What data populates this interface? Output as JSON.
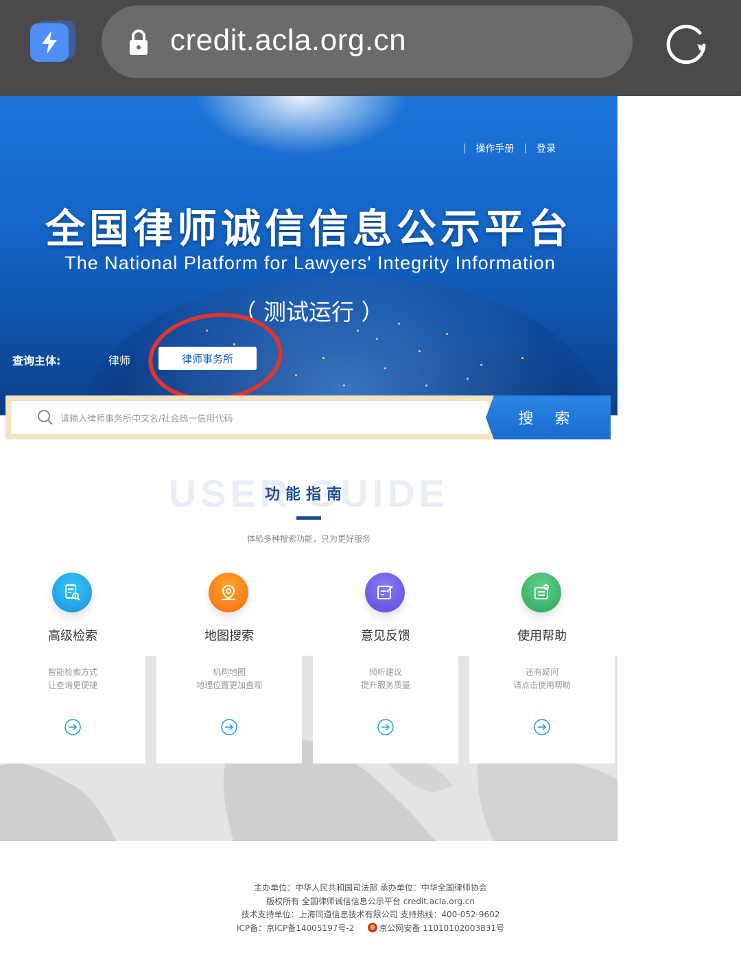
{
  "browser": {
    "url": "credit.acla.org.cn",
    "app_icon": "lightning-app-icon",
    "lock_icon": "lock-icon",
    "reload_icon": "reload-icon"
  },
  "hero": {
    "links": [
      "操作手册",
      "登录"
    ],
    "title": "全国律师诚信信息公示平台",
    "subtitle": "The National Platform for  Lawyers' Integrity Information",
    "status": "（ 测试运行 ）",
    "query_label": "查询主体:",
    "options": [
      {
        "label": "律师",
        "selected": false
      },
      {
        "label": "律师事务所",
        "selected": true
      }
    ]
  },
  "search": {
    "placeholder": "请输入律师事务所中文名/社会统一信用代码",
    "button_label": "搜 索"
  },
  "guide": {
    "watermark": "USER GUIDE",
    "title": "功能指南",
    "description": "体验多种搜索功能，只为更好服务"
  },
  "features": [
    {
      "title": "高级检索",
      "line1": "智能检索方式",
      "line2": "让查询更便捷",
      "icon": "search-document-icon",
      "color": "#1aa5e8"
    },
    {
      "title": "地图搜索",
      "line1": "机构地图",
      "line2": "地理位置更加直观",
      "icon": "map-pin-icon",
      "color": "#f5820f"
    },
    {
      "title": "意见反馈",
      "line1": "倾听建议",
      "line2": "提升服务质量",
      "icon": "feedback-edit-icon",
      "color": "#6b5ee6"
    },
    {
      "title": "使用帮助",
      "line1": "还有疑问",
      "line2": "请点击使用帮助",
      "icon": "help-notes-icon",
      "color": "#3fb66b"
    }
  ],
  "footer": {
    "line1": "主办单位：中华人民共和国司法部 承办单位：中华全国律师协会",
    "line2": "版权所有 全国律师诚信信息公示平台 credit.acla.org.cn",
    "line3": "技术支持单位：上海同道信息技术有限公司 支持热线：400-052-9602",
    "icp": "ICP备：京ICP备14005197号-2",
    "police": "京公网安备 11010102003831号"
  },
  "colors": {
    "hero_blue": "#1466c8",
    "accent_navy": "#1c4f96",
    "annotation_red": "#e0362c"
  }
}
